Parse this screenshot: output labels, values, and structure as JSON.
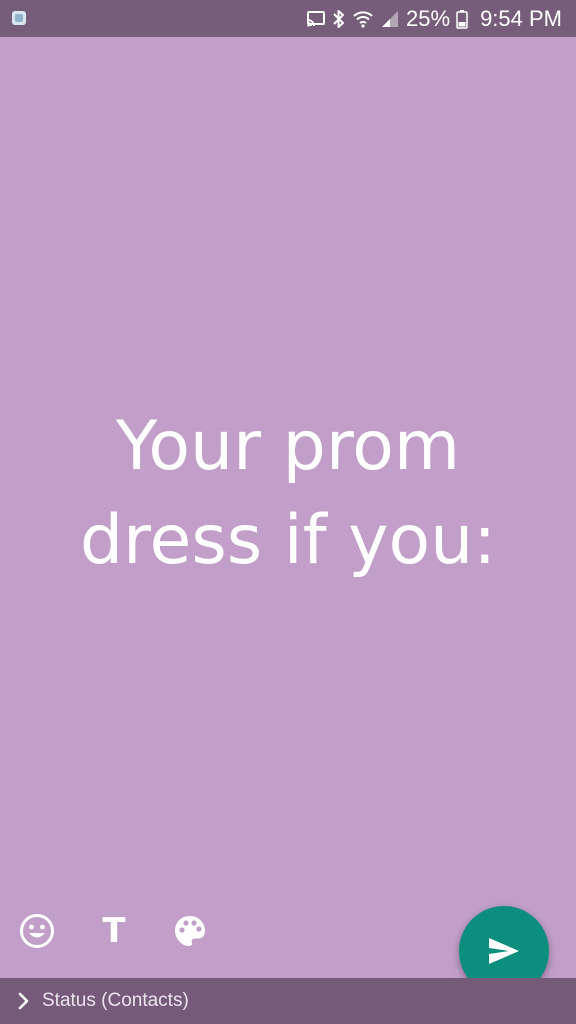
{
  "status_bar": {
    "battery_percent": "25%",
    "time": "9:54 PM",
    "icons": [
      "app-notification-icon",
      "cast-icon",
      "bluetooth-icon",
      "wifi-icon",
      "signal-icon",
      "battery-icon"
    ]
  },
  "composer": {
    "background_color": "#c29fc9",
    "text": "Your prom\ndress if you:"
  },
  "toolbar": {
    "icons": [
      "emoji-icon",
      "text-format-icon",
      "palette-icon"
    ],
    "text_button_glyph": "T"
  },
  "send_button": {
    "icon": "send-icon",
    "color": "#0b8e7d"
  },
  "footer": {
    "audience_label": "Status (Contacts)",
    "icon": "chevron-right-icon"
  }
}
